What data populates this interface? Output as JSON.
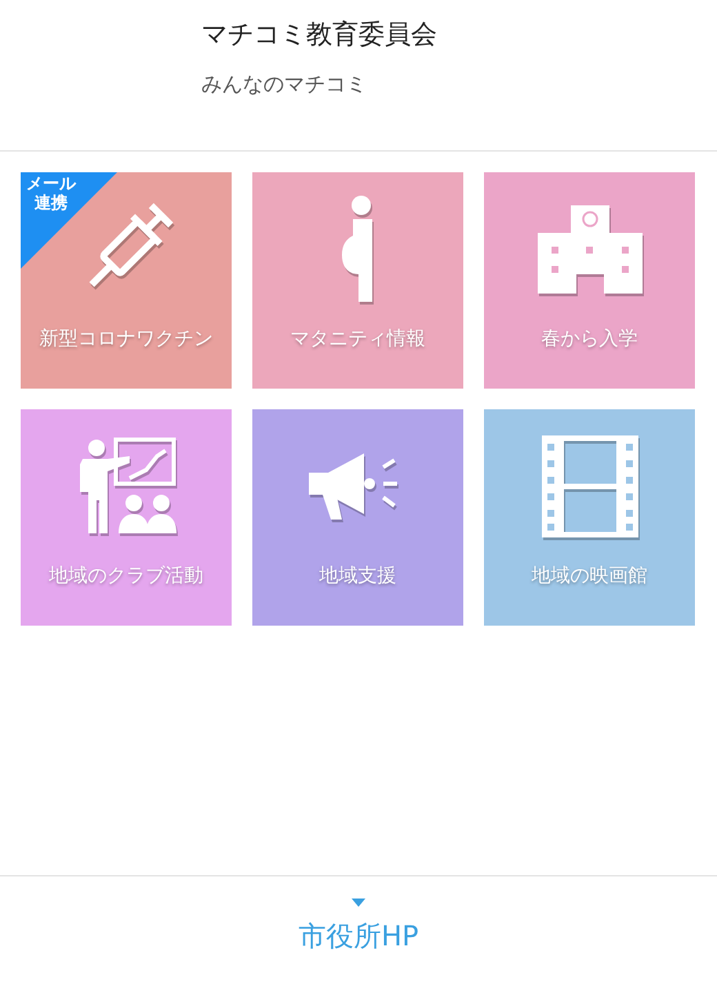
{
  "header": {
    "title": "マチコミ教育委員会",
    "subtitle": "みんなのマチコミ"
  },
  "tiles": [
    {
      "label": "新型コロナワクチン",
      "kind": "syringe",
      "color": "#e8a09d",
      "badge": "メール連携"
    },
    {
      "label": "マタニティ情報",
      "kind": "pregnant",
      "color": "#eca7bb"
    },
    {
      "label": "春から入学",
      "kind": "school",
      "color": "#eba5c8"
    },
    {
      "label": "地域のクラブ活動",
      "kind": "teacher",
      "color": "#e4a6ee"
    },
    {
      "label": "地域支援",
      "kind": "megaphone",
      "color": "#b0a3ea"
    },
    {
      "label": "地域の映画館",
      "kind": "film",
      "color": "#9dc6e7"
    }
  ],
  "footer": {
    "link": "市役所HP"
  }
}
